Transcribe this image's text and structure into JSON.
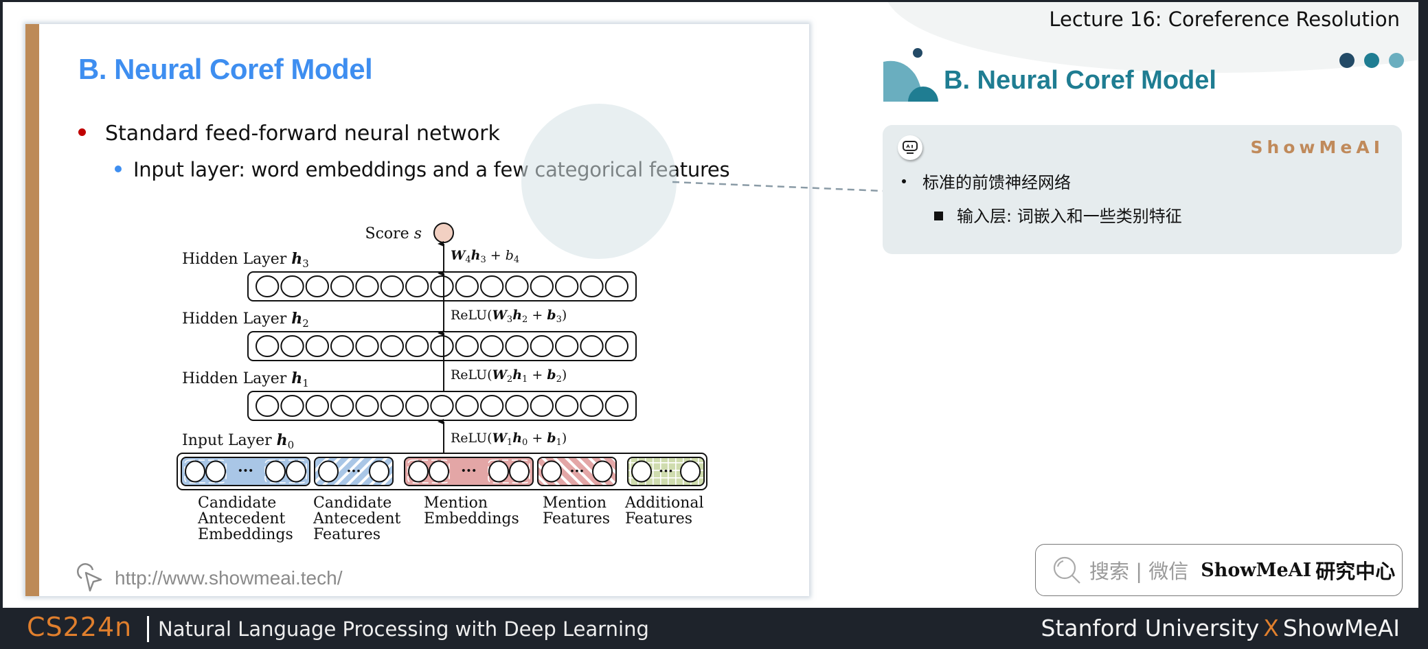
{
  "header": {
    "lecture_title": "Lecture 16: Coreference Resolution"
  },
  "slide": {
    "title": "B. Neural Coref Model",
    "bullets": [
      {
        "level": 1,
        "text": "Standard feed-forward neural network",
        "bullet_color": "#c00000"
      },
      {
        "level": 2,
        "text": "Input layer: word embeddings and a few categorical features",
        "bullet_color": "#3e8ef0"
      }
    ],
    "url": "http://www.showmeai.tech/",
    "accent_bar_color": "#bd8a57",
    "title_color": "#3e8ef0"
  },
  "diagram": {
    "output": {
      "label": "Score",
      "symbol": "s",
      "node_color": "#f2d0c2"
    },
    "layers": [
      {
        "id": "h3",
        "label": "Hidden Layer",
        "symbol": "h",
        "sub": "3",
        "units": 15,
        "transition": {
          "pre": "",
          "W": "W",
          "Wsub": "4",
          "h": "h",
          "hsub": "3",
          "b": "b",
          "bsub": "4",
          "bold_b": false,
          "relu": false
        }
      },
      {
        "id": "h2",
        "label": "Hidden Layer",
        "symbol": "h",
        "sub": "2",
        "units": 15,
        "transition": {
          "pre": "ReLU(",
          "W": "W",
          "Wsub": "3",
          "h": "h",
          "hsub": "2",
          "b": "b",
          "bsub": "3",
          "bold_b": true,
          "relu": true
        }
      },
      {
        "id": "h1",
        "label": "Hidden Layer",
        "symbol": "h",
        "sub": "1",
        "units": 15,
        "transition": {
          "pre": "ReLU(",
          "W": "W",
          "Wsub": "2",
          "h": "h",
          "hsub": "1",
          "b": "b",
          "bsub": "2",
          "bold_b": true,
          "relu": true
        }
      },
      {
        "id": "h0",
        "label": "Input Layer",
        "symbol": "h",
        "sub": "0",
        "transition": {
          "pre": "ReLU(",
          "W": "W",
          "Wsub": "1",
          "h": "h",
          "hsub": "0",
          "b": "b",
          "bsub": "1",
          "bold_b": true,
          "relu": true
        }
      }
    ],
    "input_groups": [
      {
        "name": "Candidate Antecedent Embeddings",
        "lines": [
          "Candidate",
          "Antecedent",
          "Embeddings"
        ],
        "color": "#a9c6e6",
        "pattern": "dashed-solid",
        "nodes": "4"
      },
      {
        "name": "Candidate Antecedent Features",
        "lines": [
          "Candidate",
          "Antecedent",
          "Features"
        ],
        "color": "#a9c6e6",
        "pattern": "diagonal",
        "nodes": "2"
      },
      {
        "name": "Mention Embeddings",
        "lines": [
          "Mention",
          "Embeddings"
        ],
        "color": "#e3a6a6",
        "pattern": "dashed-solid",
        "nodes": "4"
      },
      {
        "name": "Mention Features",
        "lines": [
          "Mention",
          "Features"
        ],
        "color": "#e3a6a6",
        "pattern": "diagonal",
        "nodes": "2"
      },
      {
        "name": "Additional Features",
        "lines": [
          "Additional",
          "Features"
        ],
        "color": "#cfdcae",
        "pattern": "grid",
        "nodes": "2"
      }
    ],
    "ellipsis": "···"
  },
  "side_panel": {
    "title": "B. Neural Coref Model",
    "title_color": "#1f7d92",
    "brand": "ShowMeAI",
    "brand_color": "#c08a5b",
    "dots_colors": [
      "#234a66",
      "#1f7d92",
      "#6aaebf"
    ],
    "notes": [
      {
        "level": 1,
        "text": "标准的前馈神经网络"
      },
      {
        "level": 2,
        "text": "输入层: 词嵌入和一些类别特征"
      }
    ],
    "robot_icon": "robot-face-icon"
  },
  "search": {
    "icon": "search-icon",
    "hint": "搜索 | 微信",
    "brand": "ShowMeAI",
    "suffix": "研究中心"
  },
  "footer": {
    "course_code": "CS224n",
    "course_name": "Natural Language Processing with Deep Learning",
    "credit_left": "Stanford University",
    "credit_x": "X",
    "credit_right": "ShowMeAI",
    "accent": "#e07f2d"
  }
}
